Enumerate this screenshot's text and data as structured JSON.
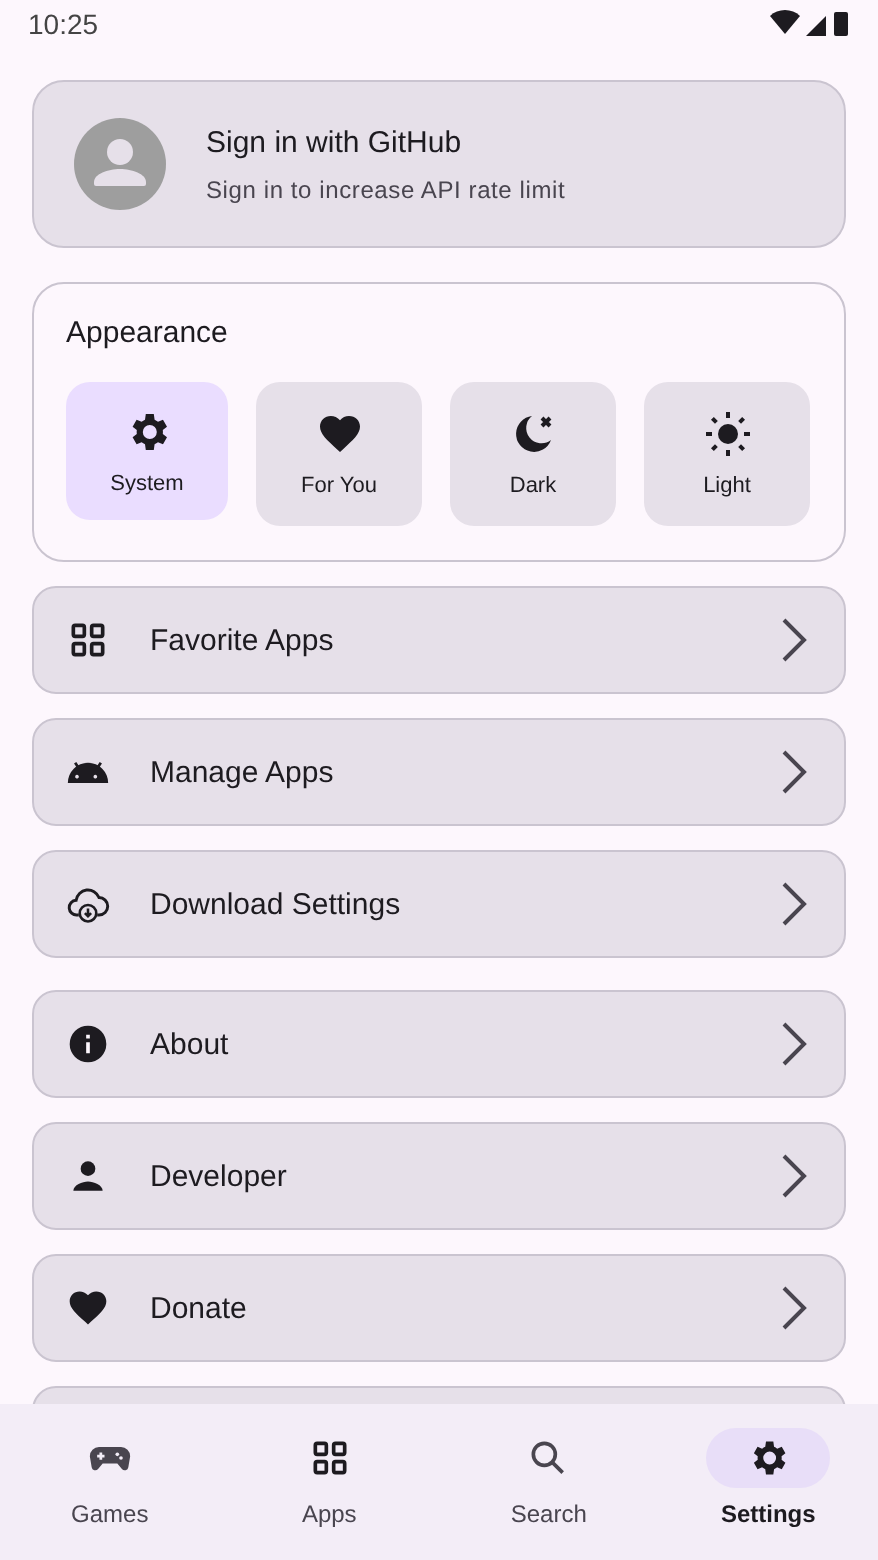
{
  "status_bar": {
    "time": "10:25"
  },
  "account": {
    "title": "Sign in with GitHub",
    "subtitle": "Sign in to increase API rate limit"
  },
  "appearance": {
    "title": "Appearance",
    "options": [
      {
        "label": "System",
        "kind": "gear",
        "selected": true
      },
      {
        "label": "For You",
        "kind": "heart",
        "selected": false
      },
      {
        "label": "Dark",
        "kind": "moon",
        "selected": false
      },
      {
        "label": "Light",
        "kind": "sun",
        "selected": false
      }
    ]
  },
  "menu_items": [
    {
      "label": "Favorite Apps",
      "kind": "grid"
    },
    {
      "label": "Manage Apps",
      "kind": "android"
    },
    {
      "label": "Download Settings",
      "kind": "cloud"
    },
    {
      "label": "About",
      "kind": "info"
    },
    {
      "label": "Developer",
      "kind": "person"
    },
    {
      "label": "Donate",
      "kind": "heart"
    }
  ],
  "bottom_nav": [
    {
      "label": "Games",
      "kind": "gamepad",
      "selected": false
    },
    {
      "label": "Apps",
      "kind": "grid",
      "selected": false
    },
    {
      "label": "Search",
      "kind": "search",
      "selected": false
    },
    {
      "label": "Settings",
      "kind": "gear",
      "selected": true
    }
  ]
}
